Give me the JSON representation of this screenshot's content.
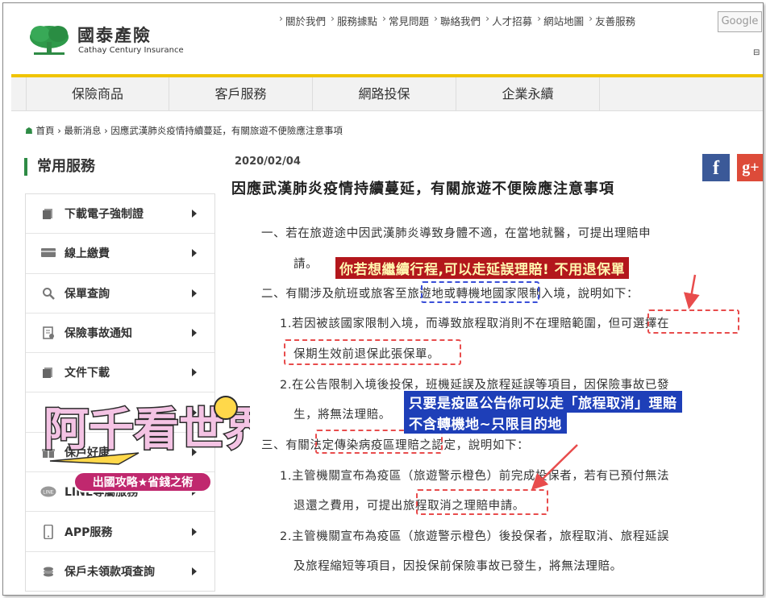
{
  "header": {
    "brand_cn": "國泰產險",
    "brand_en": "Cathay Century Insurance",
    "top_links": [
      "關於我們",
      "服務據點",
      "常見問題",
      "聯絡我們",
      "人才招募",
      "網站地圖",
      "友善服務"
    ],
    "google_label": "Google",
    "scroll_mark": "⊟"
  },
  "main_nav": [
    "保險商品",
    "客戶服務",
    "網路投保",
    "企業永續"
  ],
  "breadcrumb": {
    "home": "首頁",
    "sep": "›",
    "items": [
      "最新消息",
      "因應武漢肺炎疫情持續蔓延，有關旅遊不便險應注意事項"
    ]
  },
  "sidebar": {
    "title": "常用服務",
    "items": [
      {
        "label": "下載電子強制證",
        "icon": "document-stack-icon"
      },
      {
        "label": "線上繳費",
        "icon": "card-payment-icon"
      },
      {
        "label": "保單查詢",
        "icon": "search-icon"
      },
      {
        "label": "保險事故通知",
        "icon": "claim-form-icon"
      },
      {
        "label": "文件下載",
        "icon": "document-stack-icon"
      },
      {
        "label": "",
        "icon": "hidden-icon"
      },
      {
        "label": "保戶好康",
        "icon": "gift-icon"
      },
      {
        "label": "LINE專屬服務",
        "icon": "line-icon"
      },
      {
        "label": "APP服務",
        "icon": "phone-icon"
      },
      {
        "label": "保戶未領款項查詢",
        "icon": "coin-icon"
      }
    ]
  },
  "article": {
    "date": "2020/02/04",
    "title": "因應武漢肺炎疫情持續蔓延，有關旅遊不便險應注意事項",
    "lines": [
      "一、若在旅遊途中因武漢肺炎導致身體不適，在當地就醫，可提出理賠申",
      "請。",
      "二、有關涉及航班或旅客至旅遊地或轉機地國家限制入境，說明如下：",
      "1.若因被該國家限制入境，而導致旅程取消則不在理賠範圍，但可選擇在",
      "保期生效前退保此張保單。",
      "2.在公告限制入境後投保，班機延誤及旅程延誤等項目，因保險事故已發",
      "生，將無法理賠。",
      "三、有關法定傳染病疫區理賠之認定，說明如下：",
      "1.主管機關宣布為疫區（旅遊警示橙色）前完成投保者，若有已預付無法",
      "退還之費用，可提出旅程取消之理賠申請。",
      "2.主管機關宣布為疫區（旅遊警示橙色）後投保者，旅程取消、旅程延誤",
      "及旅程縮短等項目，因投保前保險事故已發生，將無法理賠。"
    ],
    "share": {
      "facebook": "f",
      "google_plus": "g+"
    }
  },
  "annotations": {
    "red_note": "你若想繼續行程,可以走延誤理賠! 不用退保單",
    "blue_note_1": "只要是疫區公告你可以走「旅程取消」理賠",
    "blue_note_2": "不含轉機地~只限目的地"
  },
  "watermark": {
    "title": "阿千看世界",
    "subtitle": "出國攻略★省錢之術"
  },
  "colors": {
    "brand_green": "#2e8b45",
    "nav_yellow": "#f0c400",
    "annotation_red": "#e84c4c",
    "annotation_blue": "#1e3fb8"
  }
}
